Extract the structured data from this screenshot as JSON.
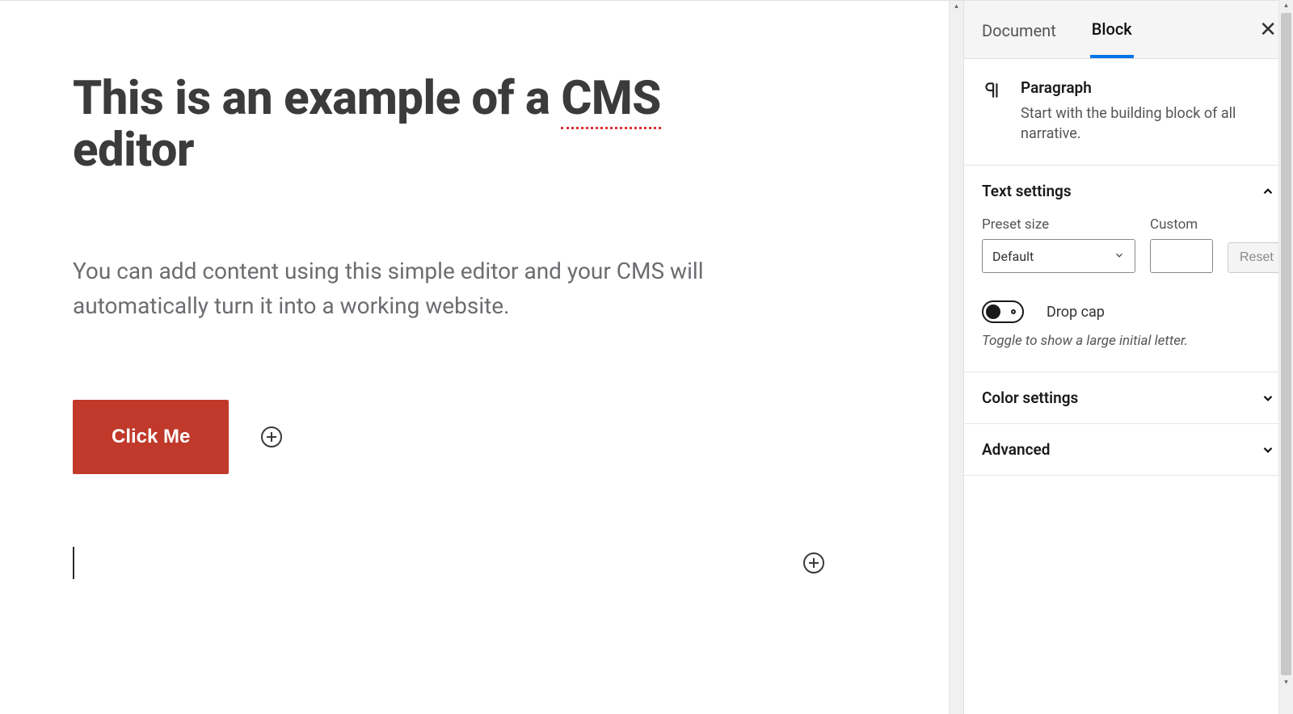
{
  "editor": {
    "title_pre": "This is an example of a ",
    "title_spell": "CMS",
    "title_post": " editor",
    "body": "You can add content using this simple editor and your CMS will automatically turn it into a working website.",
    "button_label": "Click Me"
  },
  "sidebar": {
    "tabs": {
      "document": "Document",
      "block": "Block"
    },
    "block_type": {
      "name": "Paragraph",
      "description": "Start with the building block of all narrative."
    },
    "panels": {
      "text_settings": {
        "title": "Text settings",
        "preset_label": "Preset size",
        "preset_value": "Default",
        "custom_label": "Custom",
        "custom_value": "",
        "reset_label": "Reset",
        "dropcap_label": "Drop cap",
        "dropcap_help": "Toggle to show a large initial letter."
      },
      "color_settings": {
        "title": "Color settings"
      },
      "advanced": {
        "title": "Advanced"
      }
    }
  }
}
